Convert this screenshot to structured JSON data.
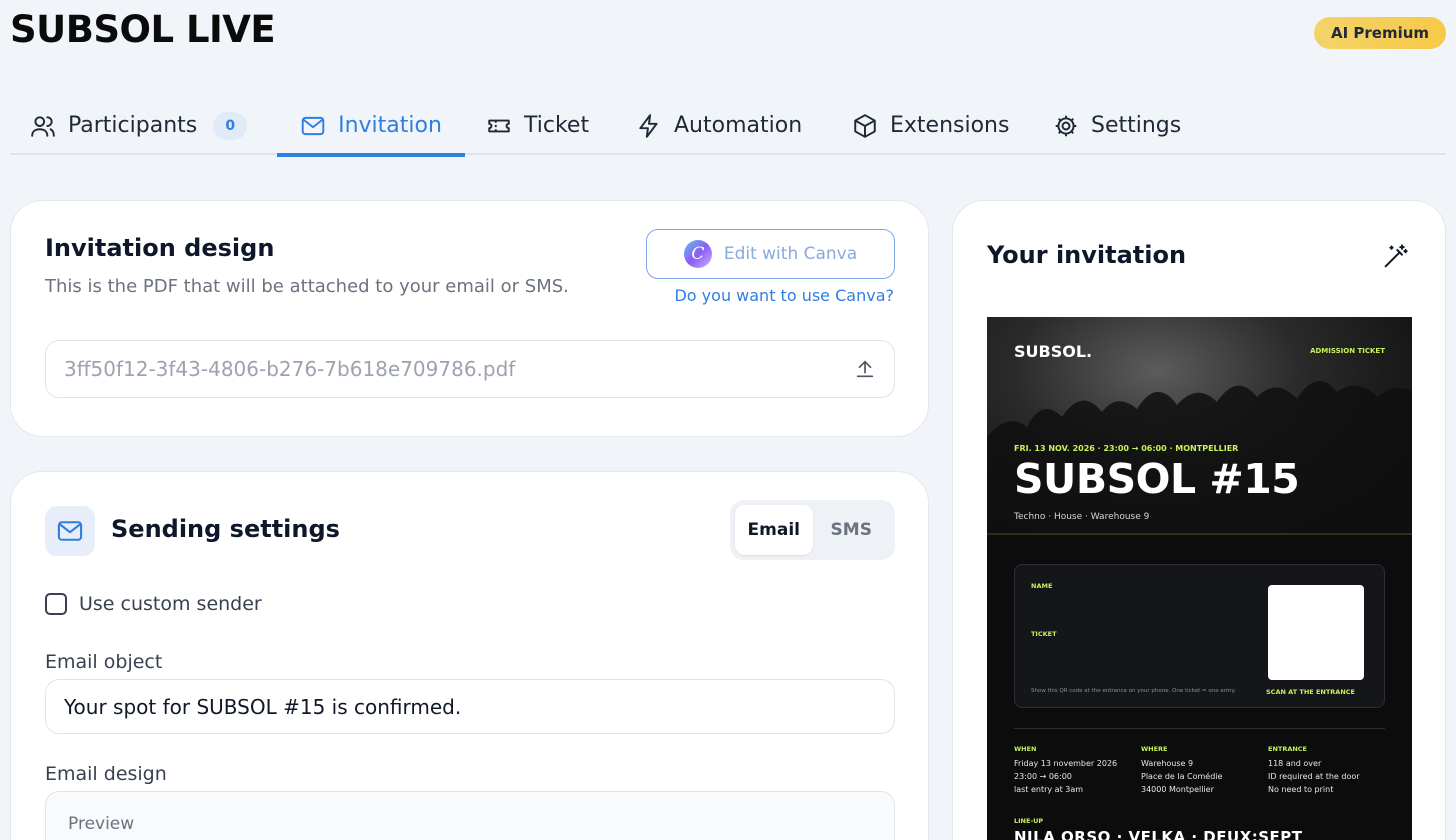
{
  "header": {
    "title": "SUBSOL LIVE",
    "badge": "AI Premium"
  },
  "tabs": [
    {
      "label": "Participants",
      "icon": "users-icon",
      "count": "0"
    },
    {
      "label": "Invitation",
      "icon": "mail-icon",
      "active": true
    },
    {
      "label": "Ticket",
      "icon": "ticket-icon"
    },
    {
      "label": "Automation",
      "icon": "bolt-icon"
    },
    {
      "label": "Extensions",
      "icon": "cube-icon"
    },
    {
      "label": "Settings",
      "icon": "gear-icon"
    }
  ],
  "design_card": {
    "title": "Invitation design",
    "subtitle": "This is the PDF that will be attached to your email or SMS.",
    "canva_button": "Edit with Canva",
    "canva_logo_letter": "C",
    "canva_link": "Do you want to use Canva?",
    "file_name": "3ff50f12-3f43-4806-b276-7b618e709786.pdf"
  },
  "sending_card": {
    "title": "Sending settings",
    "modes": [
      "Email",
      "SMS"
    ],
    "active_mode": "Email",
    "custom_sender_label": "Use custom sender",
    "email_object_label": "Email object",
    "email_object_value": "Your spot for SUBSOL #15 is confirmed.",
    "email_design_label": "Email design",
    "email_design_preview": "Preview"
  },
  "preview_card": {
    "title": "Your invitation"
  },
  "invitation": {
    "brand": "SUBSOL.",
    "admission": "ADMISSION TICKET",
    "date_line": "FRI. 13 NOV. 2026 · 23:00 → 06:00 · MONTPELLIER",
    "event_title": "SUBSOL #15",
    "genres": "Techno · House · Warehouse 9",
    "name_label": "NAME",
    "ticket_label": "TICKET",
    "qr_note": "Show this QR code at the entrance on your phone. One ticket = one entry.",
    "scan_label": "SCAN AT THE ENTRANCE",
    "when_label": "WHEN",
    "when_lines": [
      "Friday 13 november 2026",
      "23:00 → 06:00",
      "last entry at 3am"
    ],
    "where_label": "WHERE",
    "where_lines": [
      "Warehouse 9",
      "Place de la Comédie",
      "34000 Montpellier"
    ],
    "entrance_label": "ENTRANCE",
    "entrance_lines": [
      "118 and over",
      "ID required at the door",
      "No need to print"
    ],
    "lineup_label": "LINE-UP",
    "lineup": "NILA ORSO · VELKA · DEUX:SEPT"
  },
  "colors": {
    "accent": "#2f7fe0",
    "lime": "#c7f25a",
    "badge": "#f7c948"
  }
}
